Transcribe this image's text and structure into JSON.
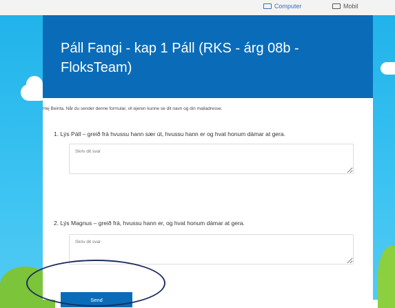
{
  "topbar": {
    "computer_label": "Computer",
    "mobile_label": "Mobil"
  },
  "form": {
    "title": "Páll Fangi - kap 1 Páll (RKS - árg 08b - FloksTeam)",
    "intro": "Hej Beinta. Når du sender denne formular, vil ejeren kunne se dit navn og din mailadresse.",
    "questions": [
      {
        "text": "1. Lýs Páll – greið frá hvussu hann sær út, hvussu hann er og hvat honum dámar at gera.",
        "placeholder": "Skriv dit svar"
      },
      {
        "text": "2. Lýs Magnus – greið frá, hvussu hann er, og hvat honum dámar at gera.",
        "placeholder": "Skriv dit svar"
      }
    ],
    "send_label": "Send"
  },
  "colors": {
    "header_blue": "#0a6cb8",
    "sky_blue": "#20b3ea",
    "annotation_ellipse": "#1e2d5c"
  }
}
